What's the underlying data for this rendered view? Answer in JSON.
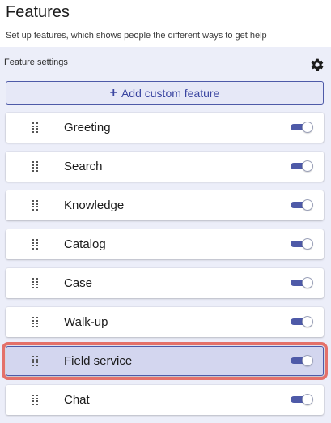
{
  "header": {
    "title": "Features",
    "subtitle": "Set up features, which shows people the different ways to get help"
  },
  "settings": {
    "label": "Feature settings",
    "gear_icon": "gear-icon",
    "add_button": {
      "icon": "+",
      "label": "Add custom feature"
    }
  },
  "features": [
    {
      "name": "Greeting",
      "enabled": true,
      "selected": false
    },
    {
      "name": "Search",
      "enabled": true,
      "selected": false
    },
    {
      "name": "Knowledge",
      "enabled": true,
      "selected": false
    },
    {
      "name": "Catalog",
      "enabled": true,
      "selected": false
    },
    {
      "name": "Case",
      "enabled": true,
      "selected": false
    },
    {
      "name": "Walk-up",
      "enabled": true,
      "selected": false
    },
    {
      "name": "Field service",
      "enabled": true,
      "selected": true
    },
    {
      "name": "Chat",
      "enabled": true,
      "selected": false
    }
  ],
  "colors": {
    "accent": "#4e5aa8",
    "panel_bg": "#eceef9",
    "selected_bg": "#d3d6ef",
    "highlight": "#e4716a"
  }
}
